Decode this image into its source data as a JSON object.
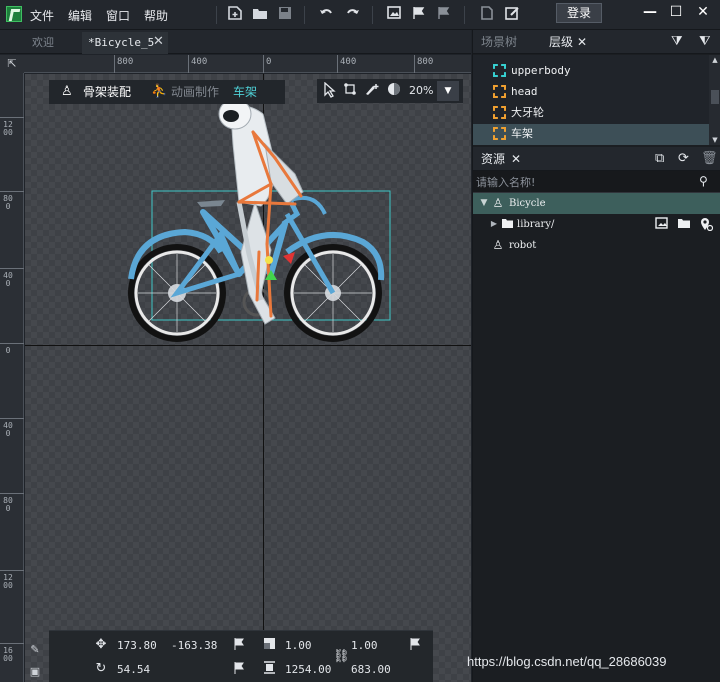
{
  "menubar": {
    "menus": [
      "文件",
      "编辑",
      "窗口",
      "帮助"
    ],
    "login_label": "登录",
    "icons": [
      "new-scene-icon",
      "open-folder-icon",
      "save-icon",
      "undo-icon",
      "redo-icon",
      "import-image-icon",
      "flag-export-icon",
      "flag-icon",
      "export-file-icon",
      "edit-icon"
    ]
  },
  "window_controls": {
    "minimize": "—",
    "maximize": "☐",
    "close": "✕"
  },
  "tabs": [
    {
      "label": "欢迎"
    },
    {
      "label": "*Bicycle_5",
      "active": true
    }
  ],
  "ruler": {
    "top": [
      "800",
      "400",
      "0",
      "400",
      "800"
    ],
    "left": [
      "1200",
      "800",
      "400",
      "0",
      "400",
      "800",
      "1200",
      "1600"
    ]
  },
  "viewport": {
    "modes": [
      "骨架装配",
      "动画制作",
      "车架"
    ],
    "zoom": "20%"
  },
  "transform": {
    "pos_x": "173.80",
    "pos_y": "-163.38",
    "rotation": "54.54",
    "scale_x": "1.00",
    "scale_y": "1.00",
    "width": "1254.00",
    "height": "683.00"
  },
  "right_panel": {
    "tabs": [
      "场景树",
      "层级"
    ],
    "layers": [
      {
        "label": "upperbody",
        "color": "#36d0d0"
      },
      {
        "label": "head",
        "color": "#f0a030"
      },
      {
        "label": "大牙轮",
        "color": "#f0a030"
      },
      {
        "label": "车架",
        "color": "#f0a030",
        "selected": true
      }
    ],
    "resources_title": "资源",
    "search_placeholder": "请输入名称!",
    "resources": [
      {
        "label": "Bicycle",
        "selected": true
      },
      {
        "label": "library/"
      },
      {
        "label": "robot"
      }
    ]
  },
  "watermark": "https://blog.csdn.net/qq_28686039"
}
